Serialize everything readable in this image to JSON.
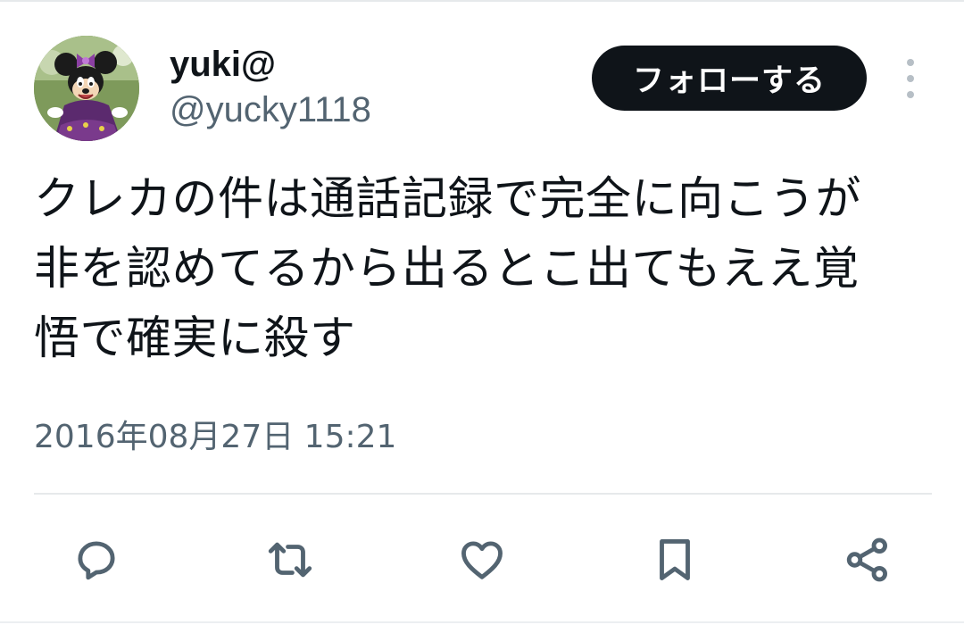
{
  "user": {
    "display_name": "yuki@",
    "handle": "@yucky1118",
    "avatar_icon": "avatar-minnie-mouse"
  },
  "follow_button": {
    "label": "フォローする"
  },
  "more_menu": {
    "icon": "more-vertical-icon"
  },
  "tweet": {
    "lines": [
      "クレカの件は通話記録で完全に向こうが",
      "非を認めてるから出るとこ出てもええ覚",
      "悟で確実に殺す"
    ],
    "timestamp": "2016年08月27日 15:21"
  },
  "actions": [
    {
      "name": "reply",
      "icon": "reply-icon"
    },
    {
      "name": "retweet",
      "icon": "retweet-icon"
    },
    {
      "name": "like",
      "icon": "heart-icon"
    },
    {
      "name": "bookmark",
      "icon": "bookmark-icon"
    },
    {
      "name": "share",
      "icon": "share-icon"
    }
  ],
  "colors": {
    "text_primary": "#0f1419",
    "text_secondary": "#536471",
    "button_bg": "#0f1419",
    "divider": "#e6e9eb"
  }
}
